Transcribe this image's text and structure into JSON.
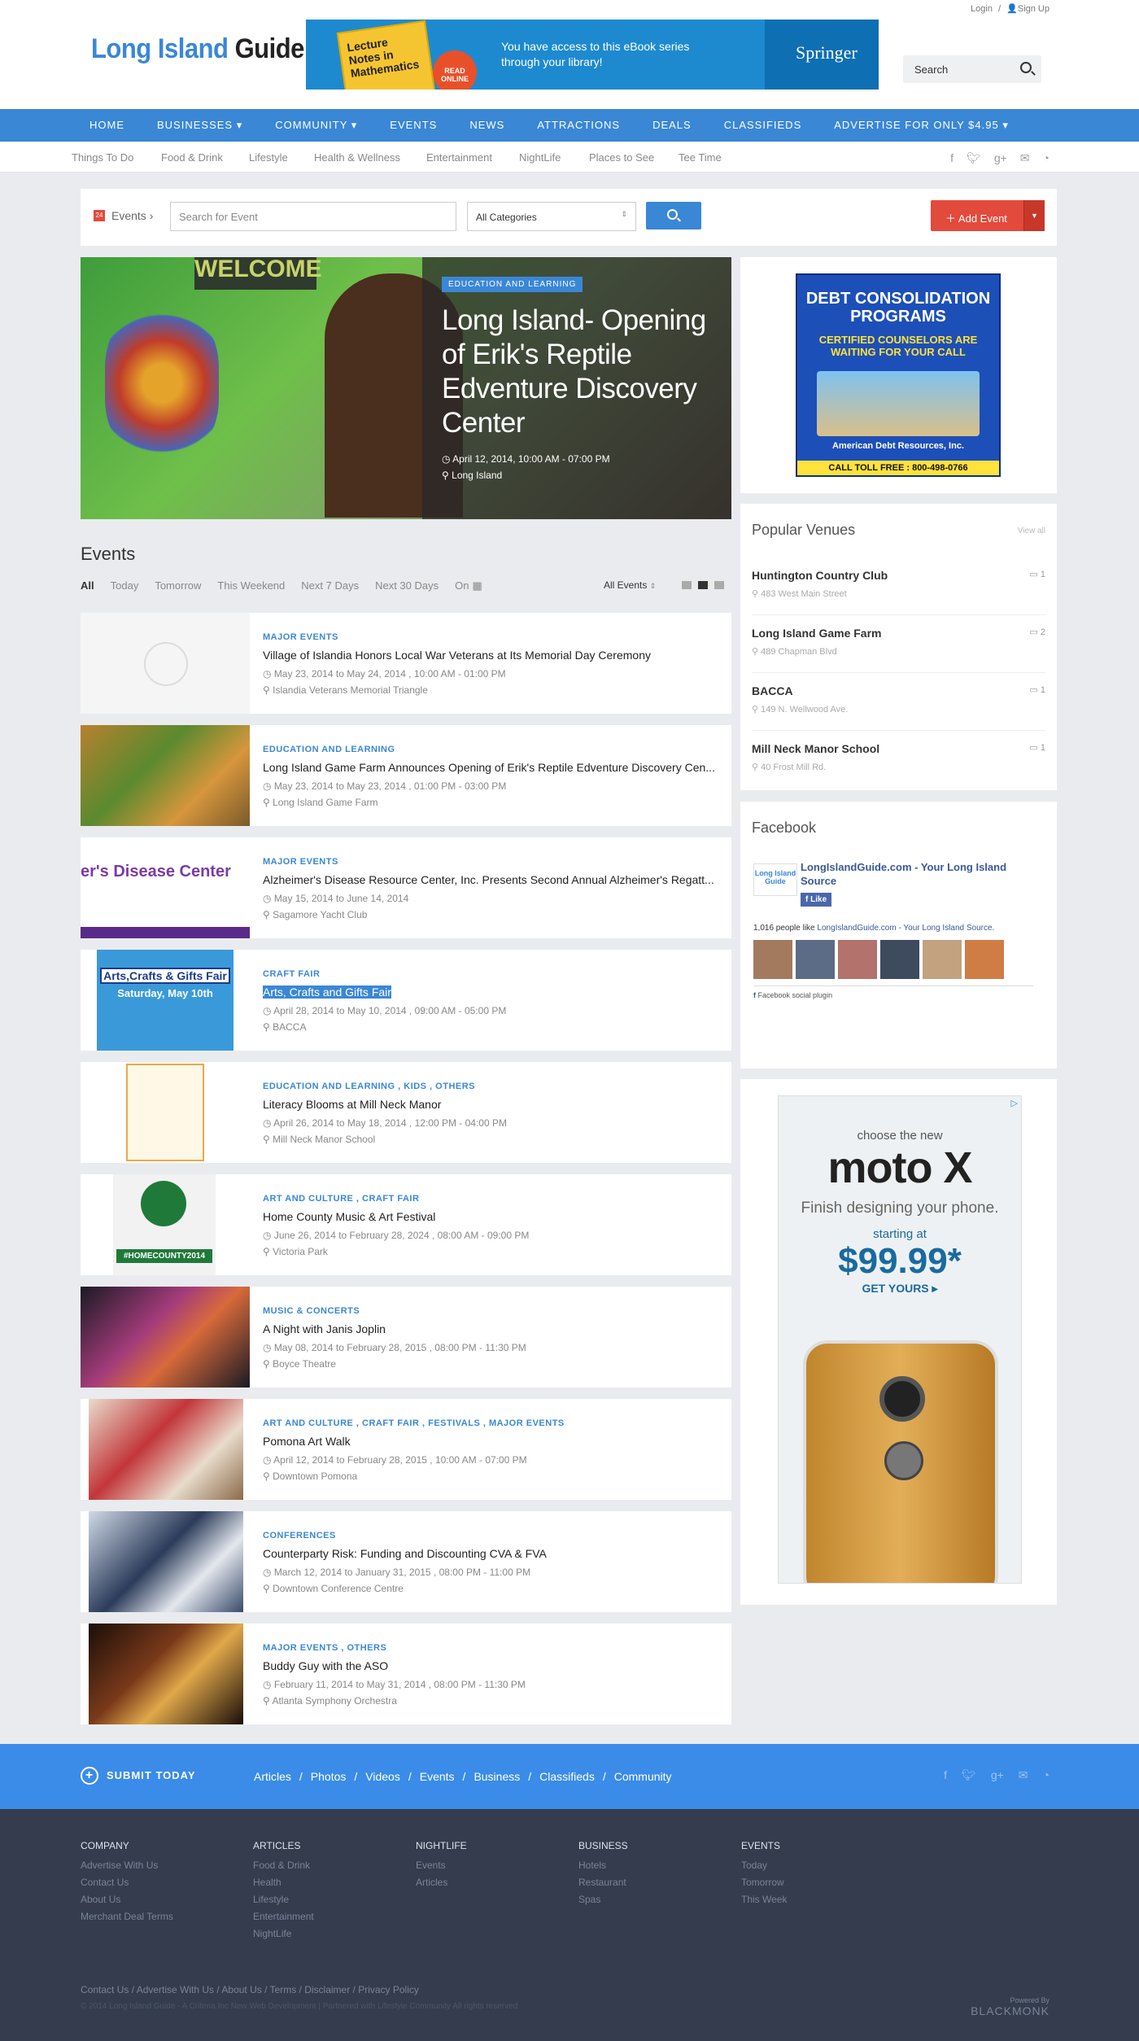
{
  "header": {
    "login": "Login",
    "separator": "/",
    "signup": "Sign Up",
    "logo_part1": "Long Island",
    "logo_part2": "Guide",
    "search_label": "Search"
  },
  "banner": {
    "book_title": "Lecture Notes in Mathematics",
    "badge": "READ ONLINE",
    "message": "You have access to this eBook series through your library!",
    "brand": "Springer"
  },
  "nav": [
    "HOME",
    "BUSINESSES ▾",
    "COMMUNITY ▾",
    "EVENTS",
    "NEWS",
    "ATTRACTIONS",
    "DEALS",
    "CLASSIFIEDS",
    "ADVERTISE FOR ONLY $4.95 ▾"
  ],
  "subnav": [
    "Things To Do",
    "Food & Drink",
    "Lifestyle",
    "Health & Wellness",
    "Entertainment",
    "NightLife",
    "Places to See",
    "Tee Time"
  ],
  "social_icons": [
    "facebook-icon",
    "twitter-icon",
    "google-plus-icon",
    "mail-icon",
    "rss-icon"
  ],
  "toolbar": {
    "calendar_day": "24",
    "events_label": "Events",
    "search_placeholder": "Search for Event",
    "category_value": "All Categories",
    "add_event": "Add Event"
  },
  "hero": {
    "wall_text": "WELCOME",
    "category": "EDUCATION AND LEARNING",
    "title": "Long Island- Opening of Erik's Reptile Edventure Discovery Center",
    "date": "April 12, 2014, 10:00 AM - 07:00 PM",
    "location": "Long Island"
  },
  "events_section": {
    "title": "Events",
    "filters": [
      "All",
      "Today",
      "Tomorrow",
      "This Weekend",
      "Next 7 Days",
      "Next 30 Days",
      "On"
    ],
    "all_events": "All Events"
  },
  "events": [
    {
      "cats": "MAJOR EVENTS",
      "name": "Village of Islandia Honors Local War Veterans at Its Memorial Day Ceremony",
      "date": "May 23, 2014 to May 24, 2014 , 10:00 AM - 01:00 PM",
      "place": "Islandia Veterans Memorial Triangle"
    },
    {
      "cats": "EDUCATION AND LEARNING",
      "name": "Long Island Game Farm Announces Opening of Erik's Reptile Edventure Discovery Cen...",
      "date": "May 23, 2014 to May 23, 2014 , 01:00 PM - 03:00 PM",
      "place": "Long Island Game Farm"
    },
    {
      "cats": "MAJOR EVENTS",
      "name": "Alzheimer's Disease Resource Center, Inc. Presents Second Annual Alzheimer's Regatt...",
      "date": "May 15, 2014 to June 14, 2014",
      "place": "Sagamore Yacht Club",
      "thumb_text": "er's Disease Center"
    },
    {
      "cats": "CRAFT FAIR",
      "name": "Arts, Crafts and Gifts Fair",
      "date": "April 28, 2014 to May 10, 2014 , 09:00 AM - 05:00 PM",
      "place": "BACCA",
      "thumb_text": "Arts,Crafts & Gifts Fair",
      "thumb_text2": "Saturday, May 10th"
    },
    {
      "cats": "EDUCATION AND LEARNING , KIDS , OTHERS",
      "name": "Literacy Blooms at Mill Neck Manor",
      "date": "April 26, 2014 to May 18, 2014 , 12:00 PM - 04:00 PM",
      "place": "Mill Neck Manor School"
    },
    {
      "cats": "ART AND CULTURE , CRAFT FAIR",
      "name": "Home County Music & Art Festival",
      "date": "June 26, 2014 to February 28, 2024 , 08:00 AM - 09:00 PM",
      "place": "Victoria Park",
      "thumb_text": "#HOMECOUNTY2014"
    },
    {
      "cats": "MUSIC & CONCERTS",
      "name": "A Night with Janis Joplin",
      "date": "May 08, 2014 to February 28, 2015 , 08:00 PM - 11:30 PM",
      "place": "Boyce Theatre"
    },
    {
      "cats": "ART AND CULTURE , CRAFT FAIR , FESTIVALS , MAJOR EVENTS",
      "name": "Pomona Art Walk",
      "date": "April 12, 2014 to February 28, 2015 , 10:00 AM - 07:00 PM",
      "place": "Downtown Pomona"
    },
    {
      "cats": "CONFERENCES",
      "name": "Counterparty Risk: Funding and Discounting CVA & FVA",
      "date": "March 12, 2014 to January 31, 2015 , 08:00 PM - 11:00 PM",
      "place": "Downtown Conference Centre"
    },
    {
      "cats": "MAJOR EVENTS , OTHERS",
      "name": "Buddy Guy with the ASO",
      "date": "February 11, 2014 to May 31, 2014 , 08:00 PM - 11:30 PM",
      "place": "Atlanta Symphony Orchestra"
    }
  ],
  "ad_debt": {
    "line1": "DEBT CONSOLIDATION PROGRAMS",
    "line2": "CERTIFIED COUNSELORS ARE WAITING FOR YOUR CALL",
    "company": "American Debt Resources, Inc.",
    "call": "CALL TOLL FREE : 800-498-0766"
  },
  "venues": {
    "title": "Popular Venues",
    "view_all": "View all",
    "items": [
      {
        "name": "Huntington Country Club",
        "addr": "483 West Main Street",
        "count": "1"
      },
      {
        "name": "Long Island Game Farm",
        "addr": "489 Chapman Blvd",
        "count": "2"
      },
      {
        "name": "BACCA",
        "addr": "149 N. Wellwood Ave.",
        "count": "1"
      },
      {
        "name": "Mill Neck Manor School",
        "addr": "40 Frost Mill Rd.",
        "count": "1"
      }
    ]
  },
  "facebook": {
    "title": "Facebook",
    "logo_text": "Long Island Guide",
    "page_name": "LongIslandGuide.com - Your Long Island Source",
    "like": "Like",
    "people_count": "1,016 people like",
    "people_page": "LongIslandGuide.com - Your Long Island Source.",
    "plugin": "Facebook social plugin"
  },
  "ad_moto": {
    "choose": "choose the new",
    "brand": "moto X",
    "tagline": "Finish designing your phone.",
    "starting": "starting at",
    "price": "$99.99*",
    "get": "GET YOURS ▸"
  },
  "footer_bar": {
    "submit": "SUBMIT TODAY",
    "links": [
      "Articles",
      "/",
      "Photos",
      "/",
      "Videos",
      "/",
      "Events",
      "/",
      "Business",
      "/",
      "Classifieds",
      "/",
      "Community"
    ]
  },
  "footer": {
    "cols": [
      {
        "head": "COMPANY",
        "items": [
          "Advertise With Us",
          "Contact Us",
          "About Us",
          "Merchant Deal Terms"
        ]
      },
      {
        "head": "ARTICLES",
        "items": [
          "Food & Drink",
          "Health",
          "Lifestyle",
          "Entertainment",
          "NightLife"
        ]
      },
      {
        "head": "NIGHTLIFE",
        "items": [
          "Events",
          "Articles"
        ]
      },
      {
        "head": "BUSINESS",
        "items": [
          "Hotels",
          "Restaurant",
          "Spas"
        ]
      },
      {
        "head": "EVENTS",
        "items": [
          "Today",
          "Tomorrow",
          "This Week"
        ]
      }
    ],
    "bottom_links": "Contact Us  /  Advertise With Us  /  About Us  /  Terms  /  Disclaimer  /  Privacy Policy",
    "copyright": "© 2014 Long Island Guide - A Criteria Inc New Web Development | Partnered with Lifestyle Community All rights reserved",
    "powered_by": "Powered By",
    "powered_name": "BLACKMONK"
  }
}
